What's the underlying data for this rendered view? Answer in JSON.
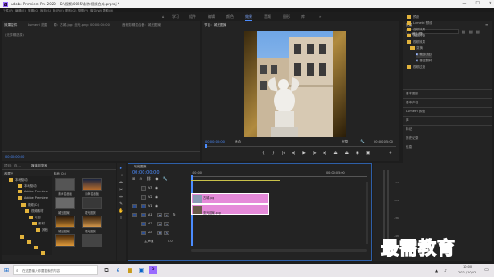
{
  "titlebar": {
    "title": "Adobe Premiere Pro 2020 - D:\\视频\\0025\\制作视频合成.prproj *",
    "app_icon": "Pr",
    "minimize": "—",
    "maximize": "☐",
    "close": "✕"
  },
  "menu": [
    "文件(F)",
    "编辑(E)",
    "剪辑(C)",
    "序列(S)",
    "标记(M)",
    "图形(G)",
    "视图(V)",
    "窗口(W)",
    "帮助(H)"
  ],
  "workspaces": [
    "学习",
    "组件",
    "编辑",
    "颜色",
    "效果",
    "音频",
    "图形",
    "库"
  ],
  "active_workspace": "效果",
  "source_panel": {
    "tabs": [
      "效果控件",
      "Lumetri 范围",
      "源：古城.jpg: 丝光.png: 00:00:00:00",
      "音频剪辑混合器：城光图案"
    ],
    "no_clip": "(无剪辑选择)",
    "timecode": "00:00:00:00"
  },
  "program": {
    "tab": "节目：城光图案",
    "timecode_left": "00:00:00:00",
    "fit": "适合",
    "quality": "完整",
    "timecode_right": "00:00:05:00"
  },
  "project": {
    "tabs": [
      "项目：自…",
      "媒体浏览器"
    ],
    "header": "收藏夹",
    "path": "本地 (D:)",
    "tree": [
      "本地驱动",
      "本地驱动",
      "Adobe Premiere",
      "Adobe Premiere",
      "视频(D:)",
      "视频素材",
      "项目",
      "素材",
      "其他"
    ],
    "thumbs": [
      "未命名面板",
      "未命名面板",
      "城光图案",
      "城光图案",
      "城光图案",
      "城光图案"
    ]
  },
  "timeline": {
    "tab": "城光图案",
    "timecode": "00:00:00:00",
    "ruler": [
      ":00:00",
      "00:00:05:00"
    ],
    "tracks_v": [
      "V3",
      "V2",
      "V1"
    ],
    "tracks_a": [
      "A1",
      "A2",
      "A3"
    ],
    "master": "主声道",
    "master_value": "0.0",
    "clip_top": "古城.jpg",
    "clip_bottom": "亚光图案.png",
    "vu_labels": [
      "-12",
      "-24",
      "-36",
      "-48"
    ]
  },
  "effects": {
    "tab": "效果",
    "search": "裁剪(视)",
    "items": [
      "预设",
      "Lumetri 预设",
      "音频效果",
      "音频过渡",
      "视频效果",
      "变换",
      "裁剪(视)",
      "垂直翻转",
      "视频过渡"
    ],
    "sections": [
      "基本图形",
      "基本声音",
      "Lumetri 颜色",
      "库",
      "标记",
      "历史记录",
      "信息"
    ]
  },
  "taskbar": {
    "search_placeholder": "在这里输入你要搜索的内容",
    "time": "10:00",
    "date": "2021/10/22"
  },
  "watermark": "最需教育"
}
